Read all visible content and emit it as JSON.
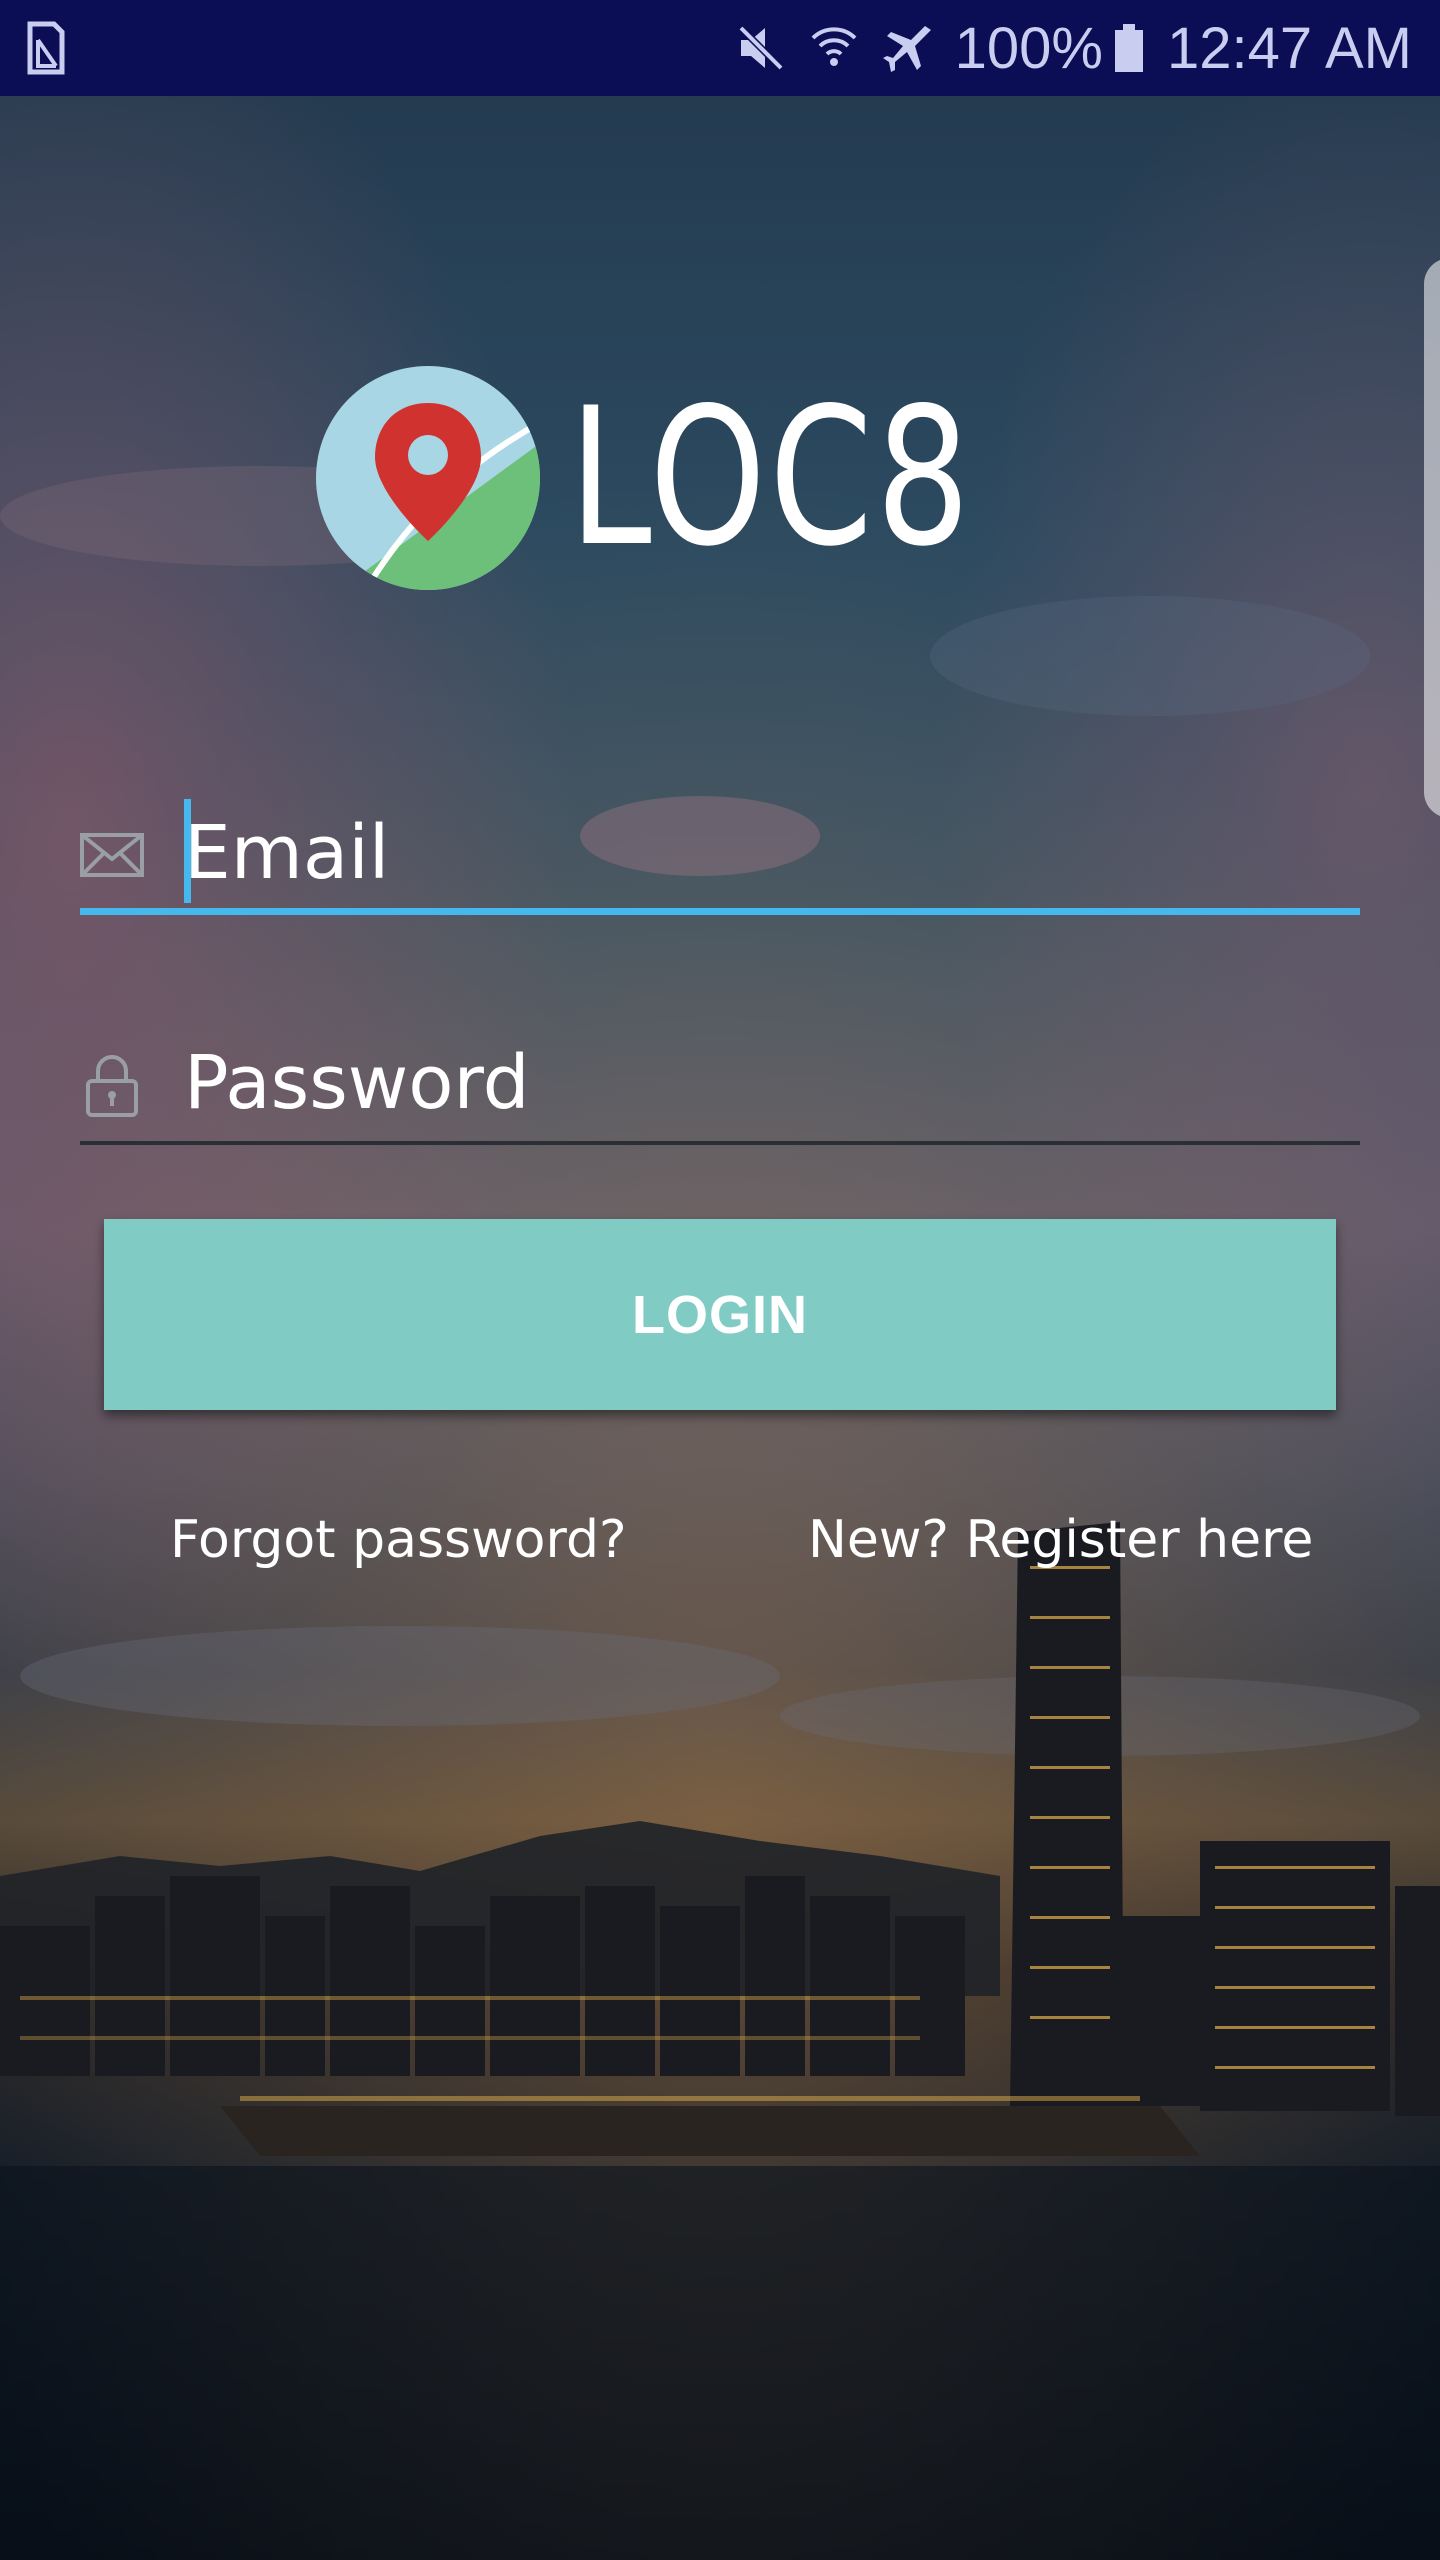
{
  "status_bar": {
    "battery": "100%",
    "time": "12:47 AM",
    "icons": [
      "sim-card-icon",
      "mute-icon",
      "wifi-icon",
      "airplane-mode-icon",
      "battery-icon"
    ]
  },
  "app": {
    "name": "LOC8",
    "logo_icon": "map-pin-icon"
  },
  "form": {
    "email": {
      "placeholder": "Email",
      "value": "",
      "icon": "envelope-icon",
      "focused": true
    },
    "password": {
      "placeholder": "Password",
      "value": "",
      "icon": "lock-icon"
    },
    "login_label": "LOGIN",
    "forgot_label": "Forgot password?",
    "register_label": "New? Register here"
  },
  "colors": {
    "status_bar": "#0b0d55",
    "accent_focus": "#45b8ee",
    "button": "#80cbc3",
    "pin": "#d0332f",
    "map_green": "#6cc07a",
    "map_blue": "#a8d6e4"
  }
}
